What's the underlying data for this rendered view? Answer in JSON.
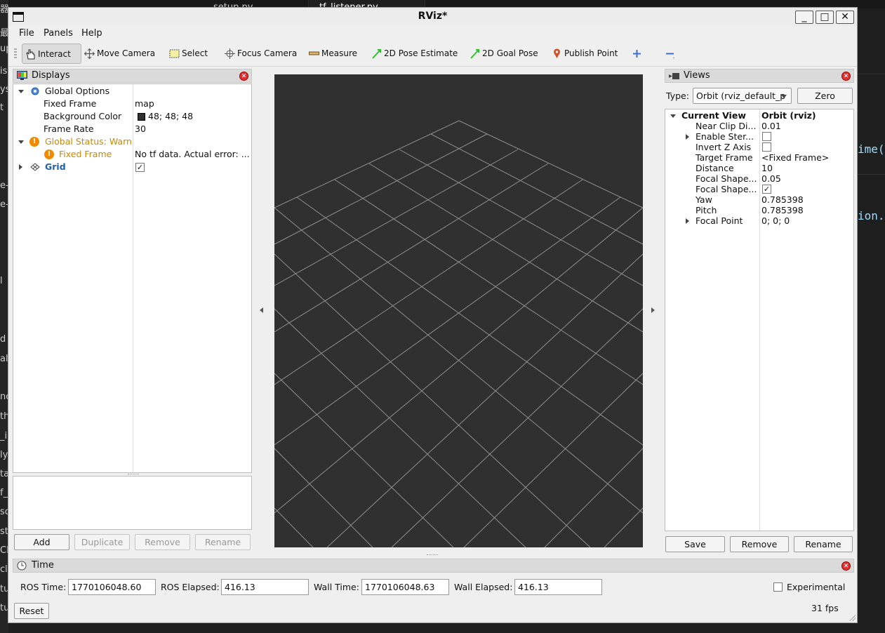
{
  "background": {
    "tabs": [
      "setup.py",
      "tf_listener.py"
    ],
    "left_fragments": [
      "器",
      "最",
      "up",
      "is",
      "ys",
      "t",
      "e-",
      "e-",
      "l",
      "d",
      "al",
      "nc",
      "th",
      "_i",
      "ly",
      "ta",
      "f_",
      "so",
      "st",
      "CE",
      "cl",
      "tu",
      "tu"
    ],
    "right_code": [
      "ime(",
      "ion."
    ]
  },
  "window": {
    "title": "RViz*",
    "minimize": "_",
    "maximize": "□",
    "close": "✕"
  },
  "menu": {
    "file": "File",
    "panels": "Panels",
    "help": "Help"
  },
  "toolbar": {
    "interact": "Interact",
    "move_camera": "Move Camera",
    "select": "Select",
    "focus_camera": "Focus Camera",
    "measure": "Measure",
    "pose_estimate": "2D Pose Estimate",
    "goal_pose": "2D Goal Pose",
    "publish_point": "Publish Point"
  },
  "displays": {
    "title": "Displays",
    "global_options": "Global Options",
    "fixed_frame_label": "Fixed Frame",
    "fixed_frame_value": "map",
    "bg_color_label": "Background Color",
    "bg_color_value": "48; 48; 48",
    "frame_rate_label": "Frame Rate",
    "frame_rate_value": "30",
    "global_status": "Global Status: Warn",
    "fixed_frame_warn": "Fixed Frame",
    "fixed_frame_error": "No tf data.  Actual error: ...",
    "grid": "Grid",
    "buttons": {
      "add": "Add",
      "duplicate": "Duplicate",
      "remove": "Remove",
      "rename": "Rename"
    }
  },
  "views": {
    "title": "Views",
    "type_label": "Type:",
    "type_value": "Orbit (rviz_default_p",
    "zero": "Zero",
    "current_view": "Current View",
    "current_view_value": "Orbit (rviz)",
    "near_clip_label": "Near Clip Di...",
    "near_clip_value": "0.01",
    "enable_stereo": "Enable Ster...",
    "invert_z": "Invert Z Axis",
    "target_frame_label": "Target Frame",
    "target_frame_value": "<Fixed Frame>",
    "distance_label": "Distance",
    "distance_value": "10",
    "focal_shape1_label": "Focal Shape...",
    "focal_shape1_value": "0.05",
    "focal_shape2_label": "Focal Shape...",
    "yaw_label": "Yaw",
    "yaw_value": "0.785398",
    "pitch_label": "Pitch",
    "pitch_value": "0.785398",
    "focal_point_label": "Focal Point",
    "focal_point_value": "0; 0; 0",
    "buttons": {
      "save": "Save",
      "remove": "Remove",
      "rename": "Rename"
    }
  },
  "time": {
    "title": "Time",
    "ros_time_label": "ROS Time:",
    "ros_time": "1770106048.60",
    "ros_elapsed_label": "ROS Elapsed:",
    "ros_elapsed": "416.13",
    "wall_time_label": "Wall Time:",
    "wall_time": "1770106048.63",
    "wall_elapsed_label": "Wall Elapsed:",
    "wall_elapsed": "416.13",
    "experimental": "Experimental",
    "reset": "Reset",
    "fps": "31 fps"
  },
  "colors": {
    "viewport_bg": "#303030",
    "warn": "#c88a00",
    "grid_blue": "#1f5fae"
  }
}
